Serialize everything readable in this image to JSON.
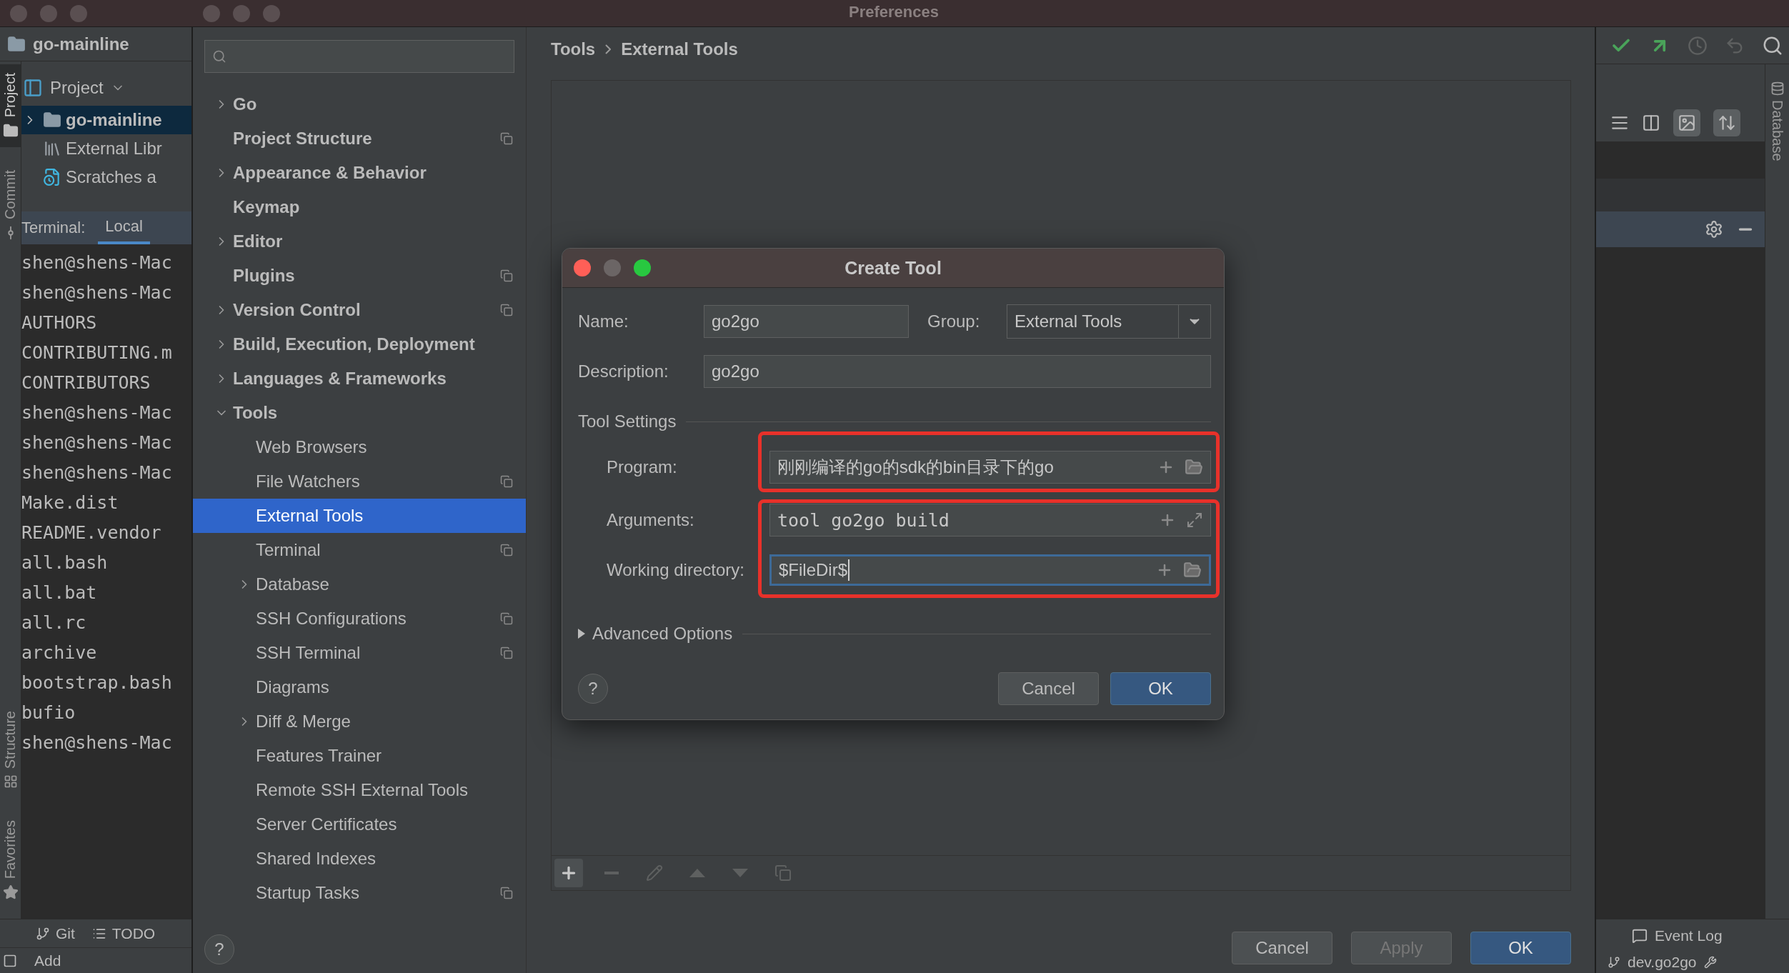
{
  "title_bar": {
    "title": "Preferences"
  },
  "ide": {
    "project_name": "go-mainline",
    "tool_windows_top": [
      {
        "label": "Project",
        "kind": "project",
        "selected": true
      },
      {
        "label": "Commit",
        "kind": "commit",
        "selected": false
      }
    ],
    "tool_windows_bottom": [
      {
        "label": "Structure",
        "kind": "structure",
        "selected": false
      },
      {
        "label": "Favorites",
        "kind": "favorites",
        "selected": false
      }
    ],
    "project_view": {
      "label": "Project"
    },
    "project_tree": [
      {
        "label": "go-mainline",
        "kind": "folder",
        "selected": true,
        "expanded": false
      },
      {
        "label": "External Libr",
        "kind": "library",
        "selected": false
      },
      {
        "label": "Scratches a",
        "kind": "scratches",
        "selected": false
      }
    ],
    "terminal": {
      "title": "Terminal:",
      "tabs": [
        {
          "label": "Local",
          "selected": true
        }
      ],
      "lines": [
        "shen@shens-Mac",
        "shen@shens-Mac",
        "AUTHORS",
        "CONTRIBUTING.m",
        "CONTRIBUTORS",
        "shen@shens-Mac",
        "shen@shens-Mac",
        "shen@shens-Mac",
        "Make.dist",
        "README.vendor",
        "all.bash",
        "all.bat",
        "all.rc",
        "archive",
        "bootstrap.bash",
        "bufio",
        "shen@shens-Mac"
      ]
    },
    "bottom_tabs": [
      {
        "label": "Git",
        "kind": "git"
      },
      {
        "label": "TODO",
        "kind": "todo"
      }
    ],
    "status_left": "Add",
    "right_side_tab": "Database",
    "event_log": "Event Log",
    "branch": "dev.go2go"
  },
  "sidebar": [
    {
      "label": "Go",
      "kind": "group",
      "expanded": false,
      "selected": false,
      "project_icon": false
    },
    {
      "label": "Project Structure",
      "kind": "page",
      "selected": false,
      "project_icon": true
    },
    {
      "label": "Appearance & Behavior",
      "kind": "group",
      "expanded": false,
      "selected": false,
      "project_icon": false
    },
    {
      "label": "Keymap",
      "kind": "page",
      "selected": false,
      "project_icon": false
    },
    {
      "label": "Editor",
      "kind": "group",
      "expanded": false,
      "selected": false,
      "project_icon": false
    },
    {
      "label": "Plugins",
      "kind": "page",
      "selected": false,
      "project_icon": true
    },
    {
      "label": "Version Control",
      "kind": "group",
      "expanded": false,
      "selected": false,
      "project_icon": true
    },
    {
      "label": "Build, Execution, Deployment",
      "kind": "group",
      "expanded": false,
      "selected": false,
      "project_icon": false
    },
    {
      "label": "Languages & Frameworks",
      "kind": "group",
      "expanded": false,
      "selected": false,
      "project_icon": false
    },
    {
      "label": "Tools",
      "kind": "group",
      "expanded": true,
      "selected": false,
      "project_icon": false,
      "children": [
        {
          "label": "Web Browsers",
          "kind": "page",
          "selected": false,
          "project_icon": false
        },
        {
          "label": "File Watchers",
          "kind": "page",
          "selected": false,
          "project_icon": true
        },
        {
          "label": "External Tools",
          "kind": "page",
          "selected": true,
          "project_icon": false
        },
        {
          "label": "Terminal",
          "kind": "page",
          "selected": false,
          "project_icon": true
        },
        {
          "label": "Database",
          "kind": "group",
          "expanded": false,
          "selected": false,
          "project_icon": false
        },
        {
          "label": "SSH Configurations",
          "kind": "page",
          "selected": false,
          "project_icon": true
        },
        {
          "label": "SSH Terminal",
          "kind": "page",
          "selected": false,
          "project_icon": true
        },
        {
          "label": "Diagrams",
          "kind": "page",
          "selected": false,
          "project_icon": false
        },
        {
          "label": "Diff & Merge",
          "kind": "group",
          "expanded": false,
          "selected": false,
          "project_icon": false
        },
        {
          "label": "Features Trainer",
          "kind": "page",
          "selected": false,
          "project_icon": false
        },
        {
          "label": "Remote SSH External Tools",
          "kind": "page",
          "selected": false,
          "project_icon": false
        },
        {
          "label": "Server Certificates",
          "kind": "page",
          "selected": false,
          "project_icon": false
        },
        {
          "label": "Shared Indexes",
          "kind": "page",
          "selected": false,
          "project_icon": false
        },
        {
          "label": "Startup Tasks",
          "kind": "page",
          "selected": false,
          "project_icon": true
        }
      ]
    }
  ],
  "help": "?",
  "breadcrumb": [
    "Tools",
    "External Tools"
  ],
  "toolbar": [
    {
      "kind": "add",
      "disabled": false
    },
    {
      "kind": "remove",
      "disabled": true
    },
    {
      "kind": "edit",
      "disabled": true
    },
    {
      "kind": "up",
      "disabled": true
    },
    {
      "kind": "down",
      "disabled": true
    },
    {
      "kind": "copy",
      "disabled": true
    }
  ],
  "buttons": [
    {
      "label": "Cancel",
      "kind": "default",
      "disabled": false
    },
    {
      "label": "Apply",
      "kind": "default",
      "disabled": true
    },
    {
      "label": "OK",
      "kind": "primary",
      "disabled": false
    }
  ],
  "dialog": {
    "title": "Create Tool",
    "name": {
      "label": "Name:",
      "value": "go2go"
    },
    "group": {
      "label": "Group:",
      "value": "External Tools"
    },
    "description": {
      "label": "Description:",
      "value": "go2go"
    },
    "section": "Tool Settings",
    "setting_groups": [
      {
        "highlighted": true,
        "fields": [
          {
            "label": "Program:",
            "value": "刚刚编译的go的sdk的bin目录下的go",
            "kind": "program",
            "focused": false
          }
        ]
      },
      {
        "highlighted": true,
        "fields": [
          {
            "label": "Arguments:",
            "value": "tool go2go build",
            "kind": "arguments",
            "focused": false
          },
          {
            "label": "Working directory:",
            "value": "$FileDir$",
            "kind": "directory",
            "focused": true
          }
        ]
      }
    ],
    "advanced": {
      "label": "Advanced Options",
      "expanded": false
    },
    "help": "?",
    "buttons": [
      {
        "label": "Cancel",
        "kind": "default"
      },
      {
        "label": "OK",
        "kind": "primary"
      }
    ]
  }
}
